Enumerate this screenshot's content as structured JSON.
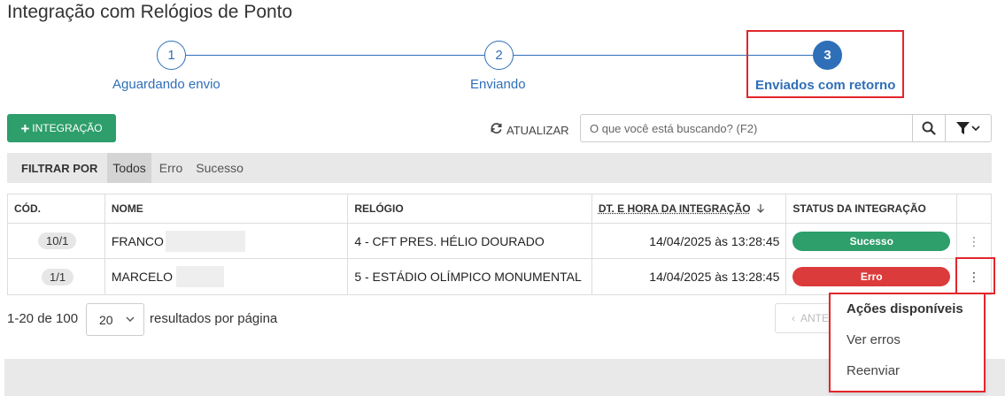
{
  "page": {
    "title": "Integração com Relógios de Ponto"
  },
  "stepper": {
    "steps": [
      {
        "number": "1",
        "label": "Aguardando envio"
      },
      {
        "number": "2",
        "label": "Enviando"
      },
      {
        "number": "3",
        "label": "Enviados com retorno",
        "active": true
      }
    ]
  },
  "toolbar": {
    "add_label": "INTEGRAÇÃO",
    "add_icon": "plus-icon",
    "refresh_label": "ATUALIZAR",
    "refresh_icon": "refresh-icon",
    "search_placeholder": "O que você está buscando? (F2)",
    "search_icon": "search-icon",
    "filter_icon": "funnel-icon"
  },
  "filter": {
    "label": "FILTRAR POR",
    "options": [
      "Todos",
      "Erro",
      "Sucesso"
    ],
    "selected": "Todos"
  },
  "table": {
    "headers": [
      "CÓD.",
      "NOME",
      "RELÓGIO",
      "DT. E HORA DA INTEGRAÇÃO",
      "STATUS DA INTEGRAÇÃO"
    ],
    "sort_icon": "arrow-down-icon",
    "rows": [
      {
        "code": "10/1",
        "name": "FRANCO",
        "clock": "4 - CFT PRES. HÉLIO DOURADO",
        "datetime": "14/04/2025 às 13:28:45",
        "status": "Sucesso",
        "status_color": "#2e9e6b"
      },
      {
        "code": "1/1",
        "name": "MARCELO",
        "clock": "5 - ESTÁDIO OLÍMPICO MONUMENTAL",
        "datetime": "14/04/2025 às 13:28:45",
        "status": "Erro",
        "status_color": "#dc3b3b"
      }
    ]
  },
  "pagination": {
    "info": "1-20 de 100",
    "page_size": "20",
    "suffix": "resultados por página",
    "prev_label": "ANTE"
  },
  "menu": {
    "title": "Ações disponíveis",
    "items": [
      "Ver erros",
      "Reenviar"
    ]
  },
  "colors": {
    "primary": "#2f6fb8",
    "success": "#2e9e6b",
    "error": "#dc3b3b",
    "highlight": "#e3262b"
  }
}
